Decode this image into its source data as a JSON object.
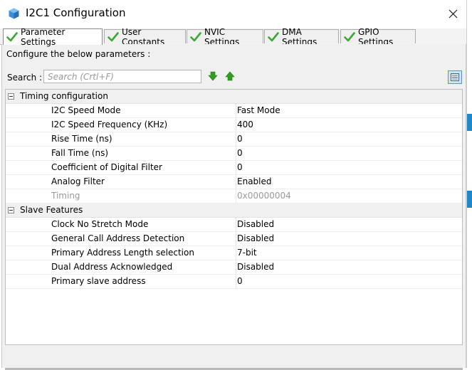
{
  "window": {
    "title": "I2C1 Configuration"
  },
  "tabs": [
    {
      "label": "Parameter Settings",
      "active": true
    },
    {
      "label": "User Constants",
      "active": false
    },
    {
      "label": "NVIC Settings",
      "active": false
    },
    {
      "label": "DMA Settings",
      "active": false
    },
    {
      "label": "GPIO Settings",
      "active": false
    }
  ],
  "instructions": "Configure the below parameters :",
  "search": {
    "label": "Search :",
    "placeholder": "Search (Crtl+F)"
  },
  "groups": [
    {
      "label": "Timing configuration",
      "params": [
        {
          "name": "I2C Speed Mode",
          "value": "Fast Mode"
        },
        {
          "name": "I2C Speed Frequency (KHz)",
          "value": "400"
        },
        {
          "name": "Rise Time (ns)",
          "value": "0"
        },
        {
          "name": "Fall Time (ns)",
          "value": "0"
        },
        {
          "name": "Coefficient of Digital Filter",
          "value": "0"
        },
        {
          "name": "Analog Filter",
          "value": "Enabled"
        },
        {
          "name": "Timing",
          "value": "0x00000004",
          "disabled": true
        }
      ]
    },
    {
      "label": "Slave Features",
      "params": [
        {
          "name": "Clock No Stretch Mode",
          "value": "Disabled"
        },
        {
          "name": "General Call Address Detection",
          "value": "Disabled"
        },
        {
          "name": "Primary Address Length selection",
          "value": "7-bit"
        },
        {
          "name": "Dual Address Acknowledged",
          "value": "Disabled"
        },
        {
          "name": "Primary slave address",
          "value": "0"
        }
      ]
    }
  ],
  "colors": {
    "check_green": "#3aa832",
    "arrow_green": "#2f9e1f",
    "accent_blue": "#1e88c8"
  }
}
